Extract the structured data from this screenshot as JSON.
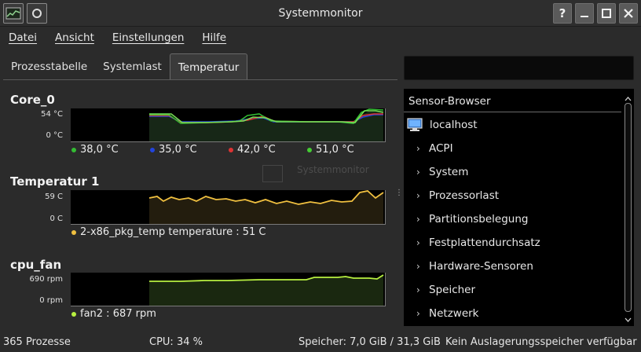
{
  "window": {
    "title": "Systemmonitor",
    "buttons": {
      "help": "?",
      "minimize": "—",
      "maximize": "☐",
      "close": "✕"
    }
  },
  "menu": [
    "Datei",
    "Ansicht",
    "Einstellungen",
    "Hilfe"
  ],
  "tabs": [
    {
      "label": "Prozesstabelle",
      "active": false
    },
    {
      "label": "Systemlast",
      "active": false
    },
    {
      "label": "Temperatur",
      "active": true
    }
  ],
  "panels": {
    "core0": {
      "title": "Core_0",
      "y_max_label": "54 °C",
      "y_min_label": "0 °C",
      "legend": [
        {
          "label": "38,0 °C",
          "color": "#33bb33"
        },
        {
          "label": "35,0 °C",
          "color": "#2244dd"
        },
        {
          "label": "42,0 °C",
          "color": "#dd3333"
        },
        {
          "label": "51,0 °C",
          "color": "#44cc33"
        }
      ]
    },
    "temp1": {
      "title": "Temperatur 1",
      "y_max_label": "59 C",
      "y_min_label": "0 C",
      "legend": [
        {
          "label": "2-x86_pkg_temp temperature : 51 C",
          "color": "#f0c040"
        }
      ]
    },
    "cpufan": {
      "title": "cpu_fan",
      "y_max_label": "690 rpm",
      "y_min_label": "0 rpm",
      "legend": [
        {
          "label": "fan2 : 687 rpm",
          "color": "#b8f040"
        }
      ]
    }
  },
  "ghost": {
    "line1": "Systemmonitor",
    "line2": ""
  },
  "sensor_browser": {
    "header": "Sensor-Browser",
    "host": "localhost",
    "items": [
      "ACPI",
      "System",
      "Prozessorlast",
      "Partitionsbelegung",
      "Festplattendurchsatz",
      "Hardware-Sensoren",
      "Speicher",
      "Netzwerk"
    ]
  },
  "status": {
    "processes": "365 Prozesse",
    "cpu": "CPU: 34 %",
    "memory": "Speicher: 7,0 GiB / 31,3 GiB",
    "swap": "Kein Auslagerungsspeicher verfügbar"
  },
  "colors": {
    "plot_bg": "#000000",
    "core0_fill": "#1a2a1a",
    "temp_fill": "#2a2414",
    "fan_fill": "#1c2a10"
  }
}
